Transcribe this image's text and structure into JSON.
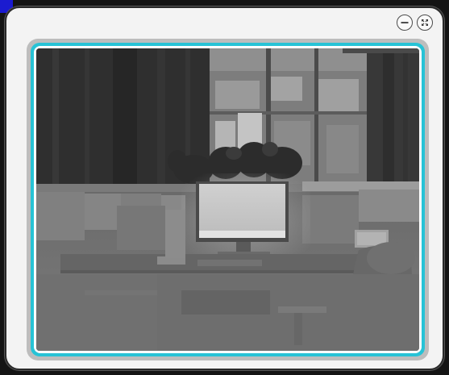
{
  "window": {
    "controls": [
      {
        "name": "minimize-button",
        "icon": "minus-circle-icon"
      },
      {
        "name": "fullscreen-button",
        "icon": "expand-arrows-icon"
      }
    ]
  },
  "viewer": {
    "frame_color": "#27c3d6",
    "content": "thermal-camera-feed"
  }
}
